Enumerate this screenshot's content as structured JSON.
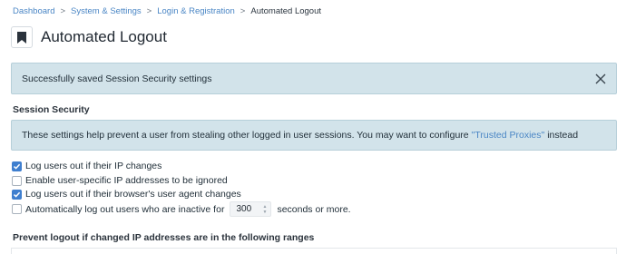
{
  "breadcrumb": {
    "items": [
      "Dashboard",
      "System & Settings",
      "Login & Registration"
    ],
    "current": "Automated Logout",
    "separator": ">"
  },
  "header": {
    "title": "Automated Logout",
    "icon": "bookmark-icon"
  },
  "success_alert": {
    "message": "Successfully saved Session Security settings",
    "close_icon": "close-icon"
  },
  "session_security": {
    "heading": "Session Security",
    "info_text": "These settings help prevent a user from stealing other logged in user sessions. You may want to configure",
    "info_link": "\"Trusted Proxies\"",
    "info_suffix": "instead",
    "options": [
      {
        "label": "Log users out if their IP changes",
        "checked": true
      },
      {
        "label": "Enable user-specific IP addresses to be ignored",
        "checked": false
      },
      {
        "label": "Log users out if their browser's user agent changes",
        "checked": true
      },
      {
        "label_prefix": "Automatically log out users who are inactive for",
        "value": "300",
        "label_suffix": "seconds or more.",
        "checked": false
      }
    ]
  },
  "ranges": {
    "heading": "Prevent logout if changed IP addresses are in the following ranges"
  },
  "colors": {
    "accent": "#3f7fcf",
    "link": "#4a86c5",
    "alert_bg": "#d2e3ea"
  }
}
